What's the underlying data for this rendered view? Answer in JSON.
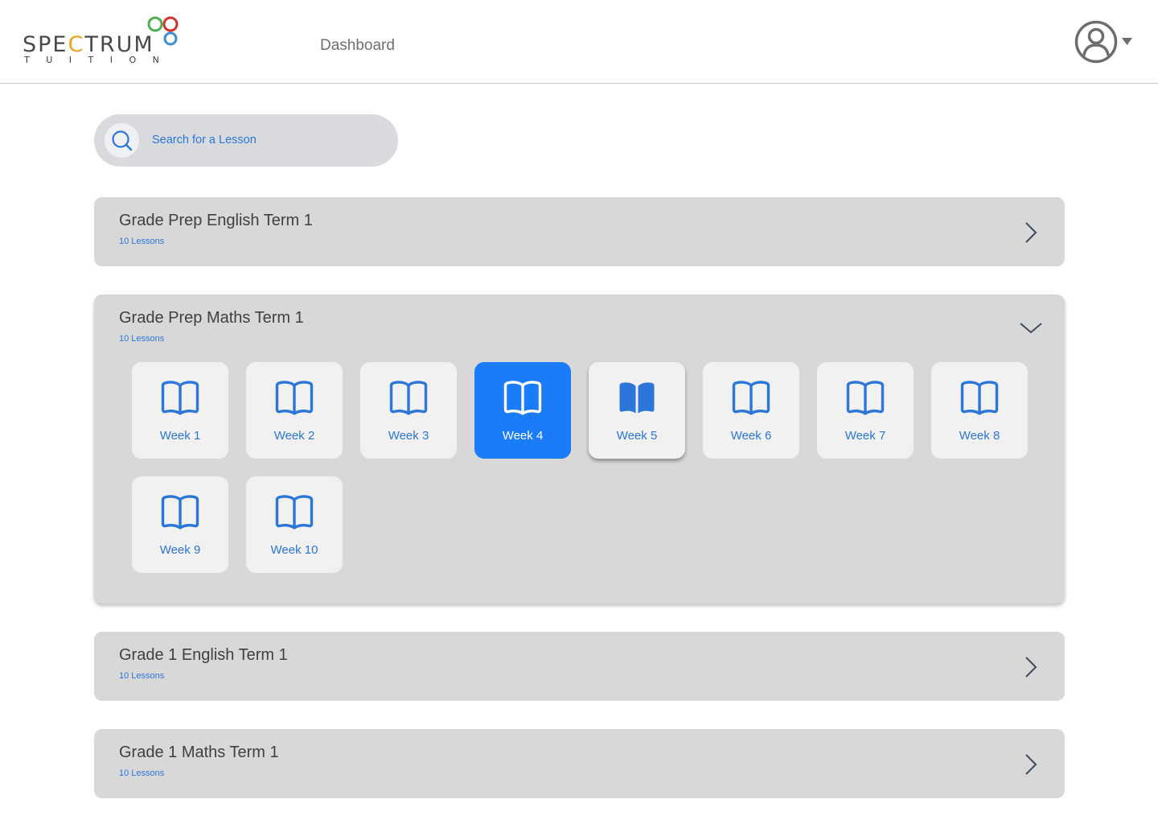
{
  "header": {
    "logo_word_left": "SPE",
    "logo_word_c": "C",
    "logo_word_right": "TRUM",
    "logo_sub": "TUITION",
    "nav_dashboard": "Dashboard"
  },
  "search": {
    "placeholder": "Search for a Lesson"
  },
  "courses": [
    {
      "title": "Grade Prep English Term 1",
      "count": "10 Lessons",
      "state": "collapsed"
    },
    {
      "title": "Grade Prep Maths Term 1",
      "count": "10 Lessons",
      "state": "expanded"
    },
    {
      "title": "Grade 1 English Term 1",
      "count": "10 Lessons",
      "state": "collapsed"
    },
    {
      "title": "Grade 1 Maths Term 1",
      "count": "10 Lessons",
      "state": "collapsed"
    }
  ],
  "weeks": [
    {
      "label": "Week 1",
      "state": "default"
    },
    {
      "label": "Week 2",
      "state": "default"
    },
    {
      "label": "Week 3",
      "state": "default"
    },
    {
      "label": "Week 4",
      "state": "selected"
    },
    {
      "label": "Week 5",
      "state": "hover"
    },
    {
      "label": "Week 6",
      "state": "default"
    },
    {
      "label": "Week 7",
      "state": "default"
    },
    {
      "label": "Week 8",
      "state": "default"
    },
    {
      "label": "Week 9",
      "state": "default"
    },
    {
      "label": "Week 10",
      "state": "default"
    }
  ],
  "icons": {
    "search": "search-icon",
    "avatar": "user-circle-icon",
    "caret": "caret-down-icon",
    "collapsed": "chevron-right-icon",
    "expanded": "chevron-down-icon",
    "week": "book-open-icon"
  },
  "colors": {
    "accent": "#1a7cf8",
    "link": "#2b76d8",
    "card": "#d8d8d8",
    "tile": "#f1f1f1",
    "logo_c": "#f0a31a",
    "ring_red": "#d3312a",
    "ring_green": "#4caf50",
    "ring_blue": "#3b8fd6"
  }
}
